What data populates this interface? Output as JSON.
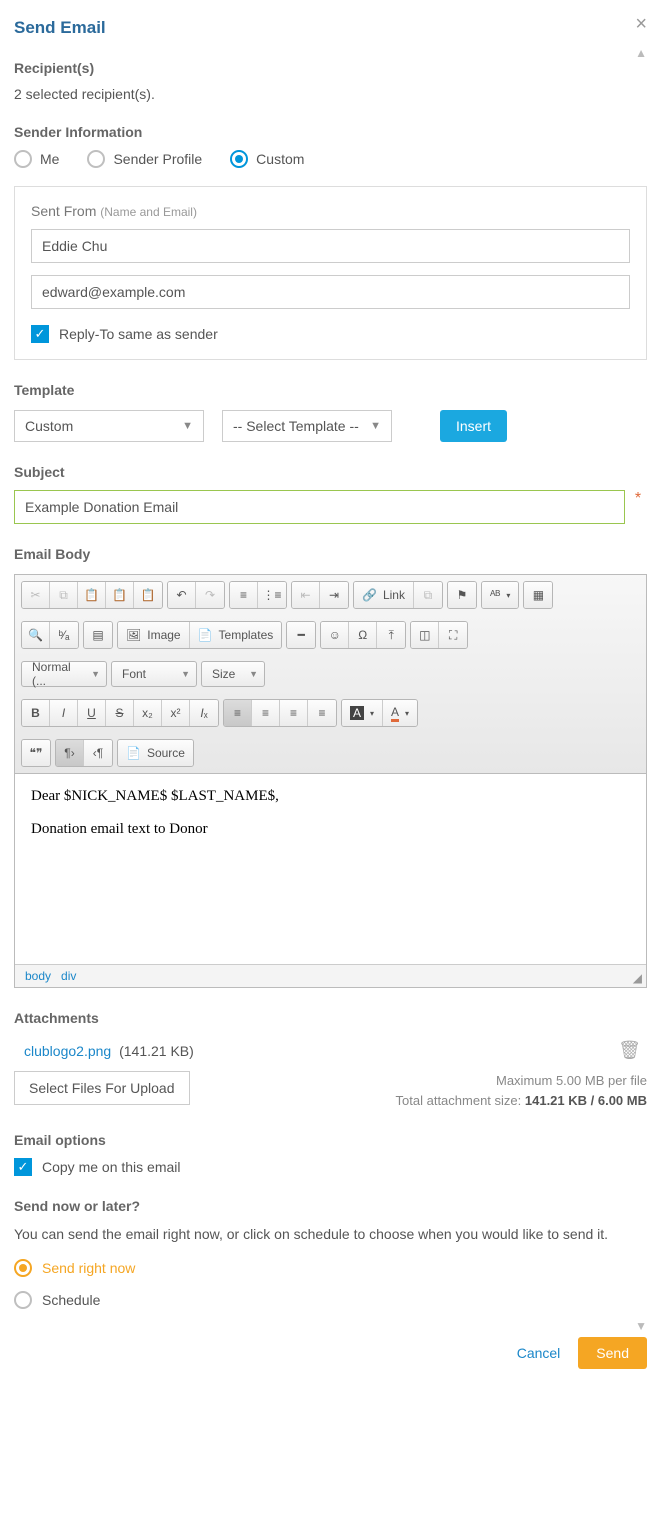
{
  "title": "Send Email",
  "recipients": {
    "heading": "Recipient(s)",
    "summary": "2 selected recipient(s)."
  },
  "sender": {
    "heading": "Sender Information",
    "options": {
      "me": "Me",
      "profile": "Sender Profile",
      "custom": "Custom"
    },
    "selected": "custom",
    "sent_from_label": "Sent From",
    "sent_from_hint": "(Name and Email)",
    "name_value": "Eddie Chu",
    "email_value": "edward@example.com",
    "reply_to_label": "Reply-To same as sender",
    "reply_to_checked": true
  },
  "template": {
    "heading": "Template",
    "category_value": "Custom",
    "template_value": "-- Select Template --",
    "insert_label": "Insert"
  },
  "subject": {
    "heading": "Subject",
    "value": "Example Donation Email"
  },
  "body": {
    "heading": "Email Body",
    "toolbar": {
      "link": "Link",
      "image": "Image",
      "templates": "Templates",
      "format": "Normal (...",
      "font": "Font",
      "size": "Size",
      "source": "Source"
    },
    "content_line1": "Dear $NICK_NAME$ $LAST_NAME$,",
    "content_line2": "Donation email text to Donor",
    "path_body": "body",
    "path_div": "div"
  },
  "attachments": {
    "heading": "Attachments",
    "file_name": "clublogo2.png",
    "file_size": "(141.21 KB)",
    "select_button": "Select Files For Upload",
    "max_per_file": "Maximum 5.00 MB per file",
    "total_prefix": "Total attachment size: ",
    "total_used": "141.21 KB / 6.00 MB"
  },
  "options": {
    "heading": "Email options",
    "copy_me_label": "Copy me on this email",
    "copy_me_checked": true
  },
  "schedule": {
    "heading": "Send now or later?",
    "description": "You can send the email right now, or click on schedule to choose when you would like to send it.",
    "send_now_label": "Send right now",
    "schedule_label": "Schedule",
    "selected": "now"
  },
  "footer": {
    "cancel": "Cancel",
    "send": "Send"
  }
}
